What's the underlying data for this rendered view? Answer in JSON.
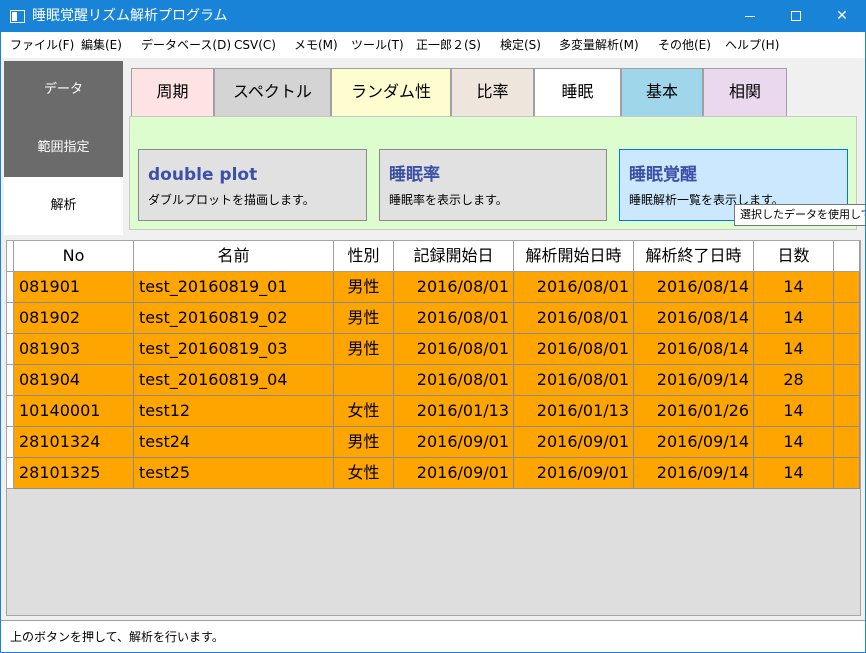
{
  "window": {
    "title": "睡眠覚醒リズム解析プログラム"
  },
  "menu": [
    "ファイル(F)",
    "編集(E)",
    "データベース(D)",
    "CSV(C)",
    "メモ(M)",
    "ツール(T)",
    "正一郎２(S)",
    "検定(S)",
    "多変量解析(M)",
    "その他(E)",
    "ヘルプ(H)"
  ],
  "nav": {
    "data": "データ",
    "range": "範囲指定",
    "analysis": "解析",
    "selected": "解析"
  },
  "tabs": [
    "周期",
    "スペクトル",
    "ランダム性",
    "比率",
    "睡眠",
    "基本",
    "相関"
  ],
  "active_tab": "睡眠",
  "actions": [
    {
      "title": "double plot",
      "desc": "ダブルプロットを描画します。"
    },
    {
      "title": "睡眠率",
      "desc": "睡眠率を表示します。"
    },
    {
      "title": "睡眠覚醒",
      "desc": "睡眠解析一覧を表示します。"
    }
  ],
  "tooltip": "選択したデータを使用して、",
  "table": {
    "columns": [
      "No",
      "名前",
      "性別",
      "記録開始日",
      "解析開始日時",
      "解析終了日時",
      "日数"
    ],
    "rows": [
      [
        "081901",
        "test_20160819_01",
        "男性",
        "2016/08/01",
        "2016/08/01",
        "2016/08/14",
        "14"
      ],
      [
        "081902",
        "test_20160819_02",
        "男性",
        "2016/08/01",
        "2016/08/01",
        "2016/08/14",
        "14"
      ],
      [
        "081903",
        "test_20160819_03",
        "男性",
        "2016/08/01",
        "2016/08/01",
        "2016/08/14",
        "14"
      ],
      [
        "081904",
        "test_20160819_04",
        "",
        "2016/08/01",
        "2016/08/01",
        "2016/09/14",
        "28"
      ],
      [
        "10140001",
        "test12",
        "女性",
        "2016/01/13",
        "2016/01/13",
        "2016/01/26",
        "14"
      ],
      [
        "28101324",
        "test24",
        "男性",
        "2016/09/01",
        "2016/09/01",
        "2016/09/14",
        "14"
      ],
      [
        "28101325",
        "test25",
        "女性",
        "2016/09/01",
        "2016/09/01",
        "2016/09/14",
        "14"
      ]
    ]
  },
  "colors": {
    "row_highlight": "#ffa500",
    "title_bar": "#1883d7",
    "panel": "#ddfdce",
    "action_title": "#3c50a8"
  },
  "status": "上のボタンを押して、解析を行います。"
}
